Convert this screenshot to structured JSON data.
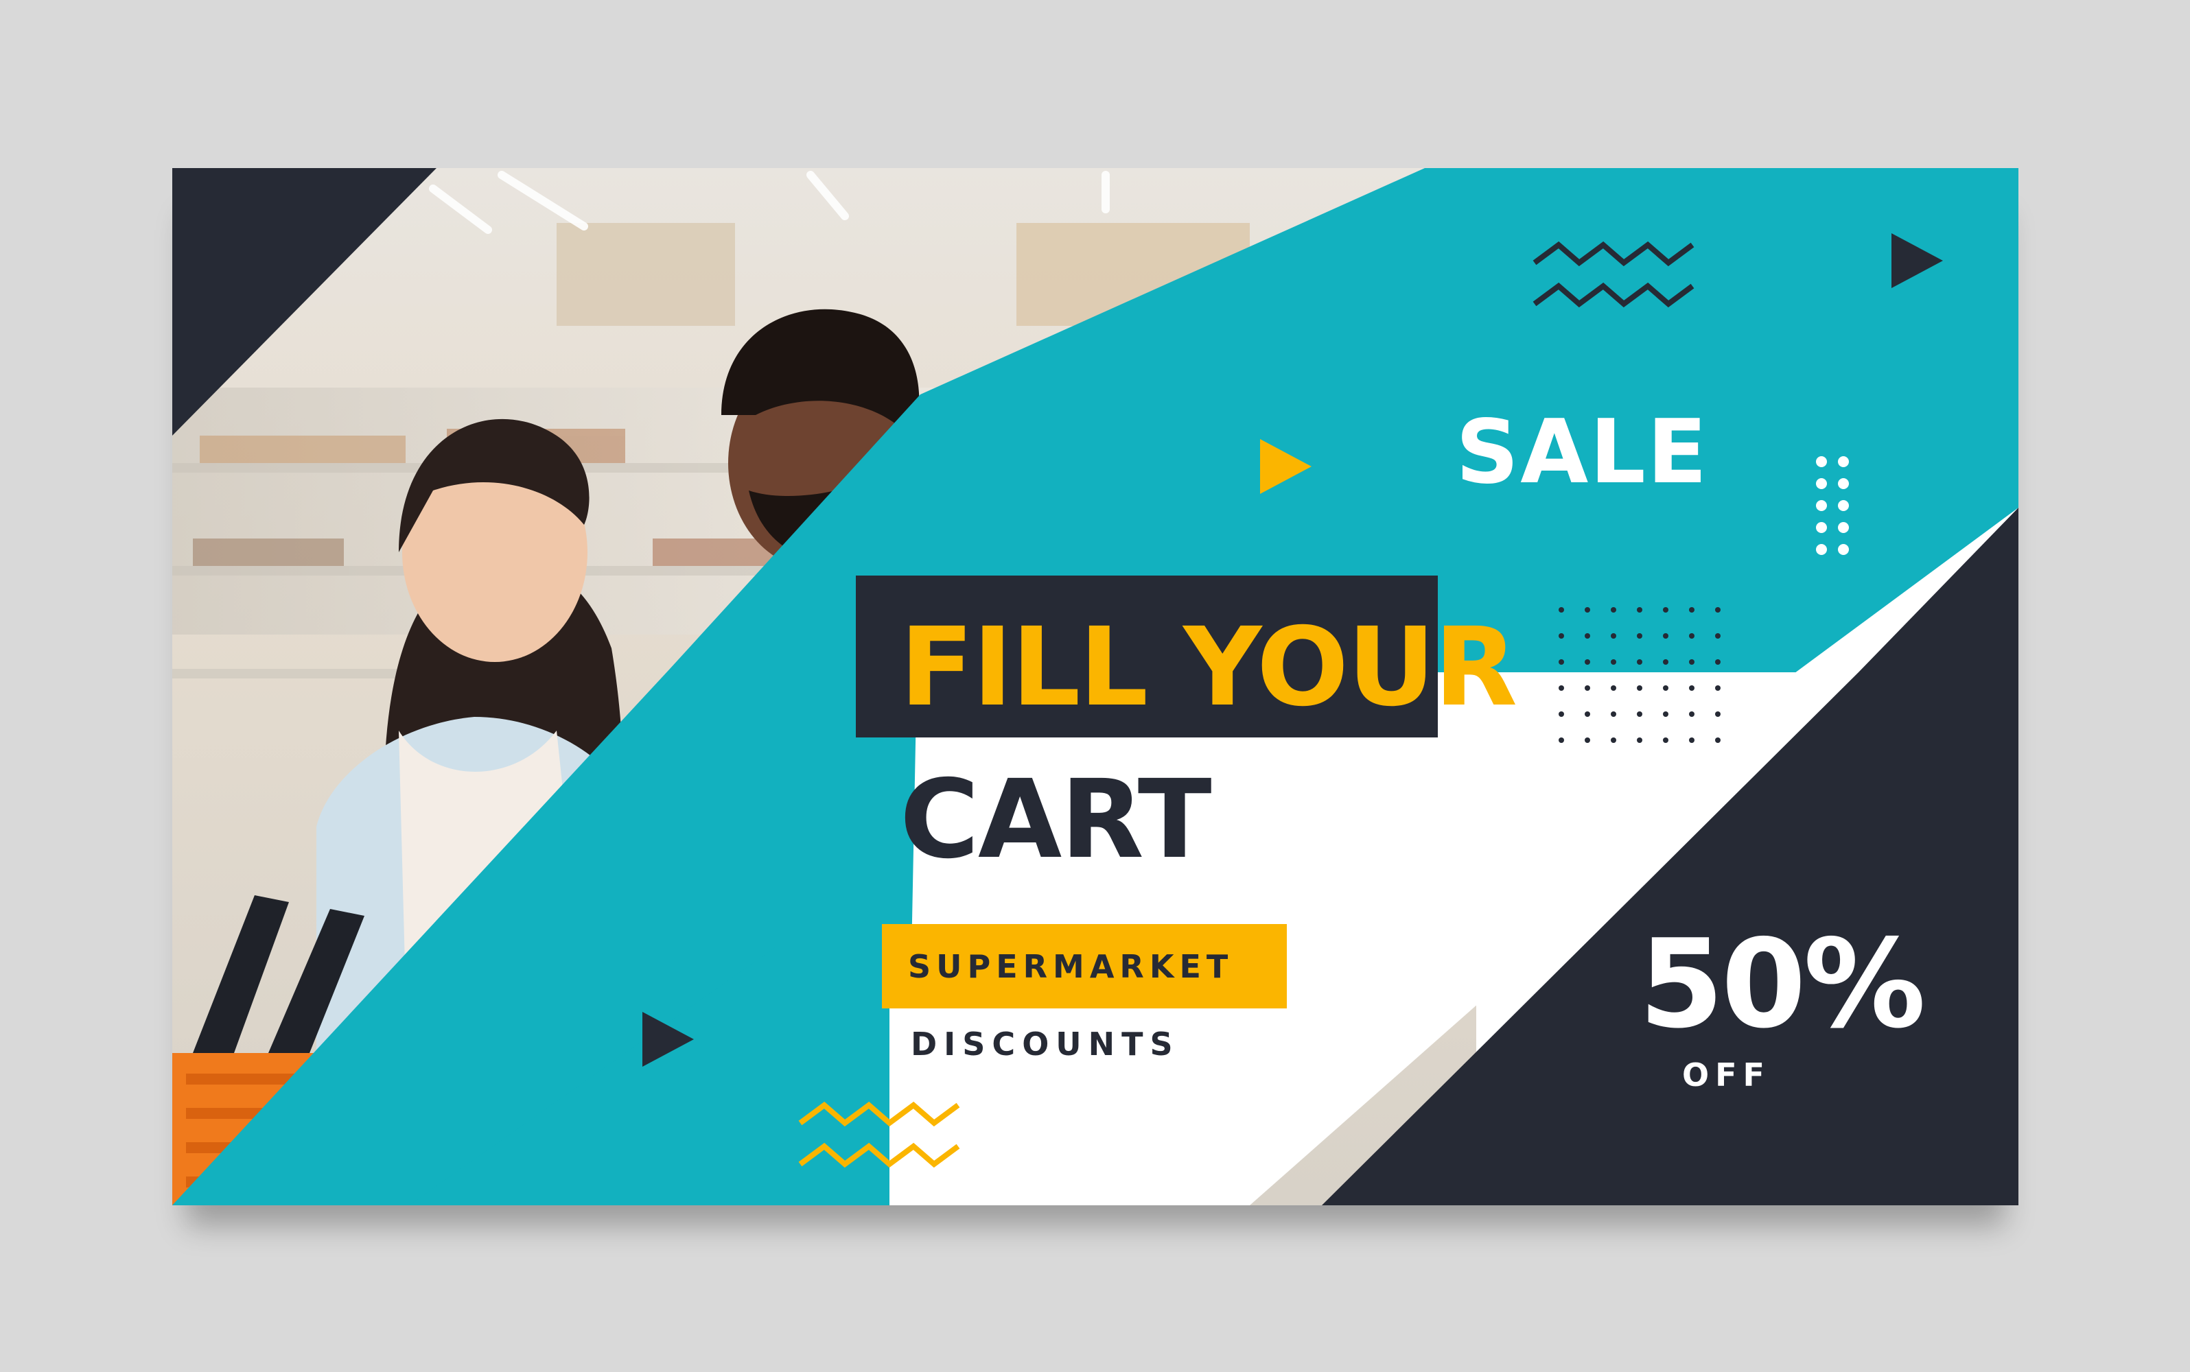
{
  "banner": {
    "sale_label": "SALE",
    "headline_line1": "FILL YOUR",
    "headline_line2": "CART",
    "badge_label": "SUPERMARKET",
    "sub_label": "DISCOUNTS",
    "discount_value": "50%",
    "discount_suffix": "OFF"
  },
  "colors": {
    "teal": "#12b1bf",
    "navy": "#262a35",
    "yellow": "#fbb500",
    "white": "#ffffff",
    "background": "#d9d9d9"
  },
  "decorations": {
    "arrow_icons": [
      "play-triangle-icon",
      "play-triangle-icon",
      "play-triangle-icon"
    ],
    "zigzag_icons": [
      "zigzag-icon",
      "zigzag-icon"
    ],
    "dot_grids": [
      "dot-grid-icon",
      "dot-grid-icon"
    ]
  }
}
